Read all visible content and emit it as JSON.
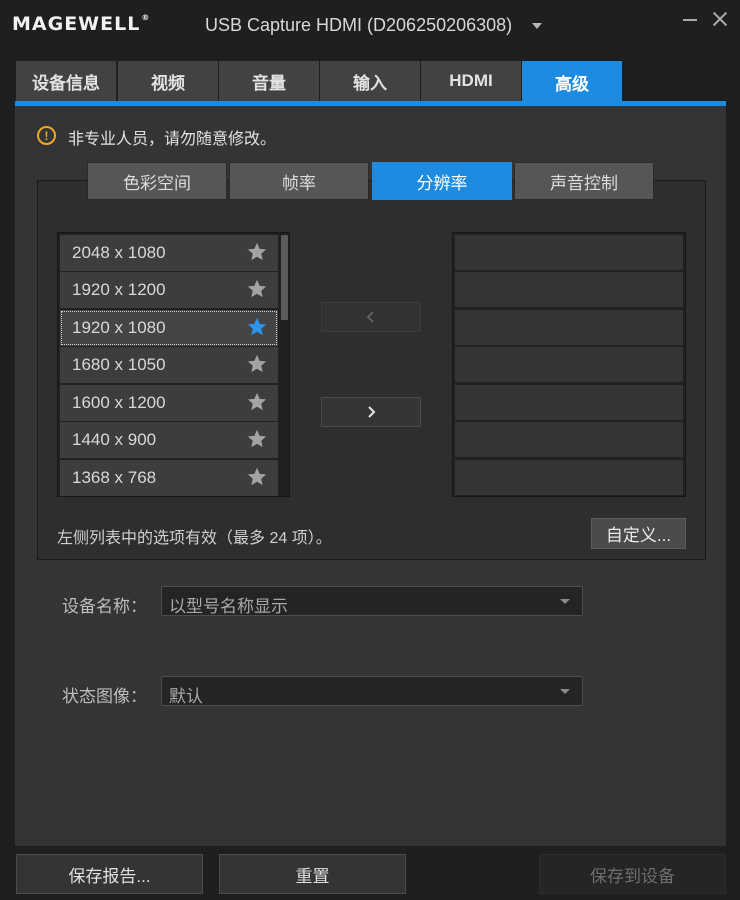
{
  "window": {
    "logo": "MAGEWELL",
    "logo_reg": "®",
    "device_title": "USB Capture HDMI (D206250206308)"
  },
  "tabs": [
    {
      "label": "设备信息",
      "active": false
    },
    {
      "label": "视频",
      "active": false
    },
    {
      "label": "音量",
      "active": false
    },
    {
      "label": "输入",
      "active": false
    },
    {
      "label": "HDMI",
      "active": false
    },
    {
      "label": "高级",
      "active": true
    }
  ],
  "warning": {
    "icon": "warning-icon",
    "text": "非专业人员，请勿随意修改。"
  },
  "subtabs": [
    {
      "label": "色彩空间",
      "active": false
    },
    {
      "label": "帧率",
      "active": false
    },
    {
      "label": "分辨率",
      "active": true
    },
    {
      "label": "声音控制",
      "active": false
    }
  ],
  "resolutions": [
    {
      "label": "2048 x 1080",
      "starred": false,
      "selected": false
    },
    {
      "label": "1920 x 1200",
      "starred": false,
      "selected": false
    },
    {
      "label": "1920 x 1080",
      "starred": true,
      "selected": true
    },
    {
      "label": "1680 x 1050",
      "starred": false,
      "selected": false
    },
    {
      "label": "1600 x 1200",
      "starred": false,
      "selected": false
    },
    {
      "label": "1440 x 900",
      "starred": false,
      "selected": false
    },
    {
      "label": "1368 x 768",
      "starred": false,
      "selected": false
    }
  ],
  "hint": "左侧列表中的选项有效（最多 24 项）。",
  "custom_button": "自定义...",
  "device_name": {
    "label": "设备名称：",
    "value": "以型号名称显示"
  },
  "status_image": {
    "label": "状态图像：",
    "value": "默认"
  },
  "bottom": {
    "save_report": "保存报告...",
    "reset": "重置",
    "save_to_device": "保存到设备"
  },
  "colors": {
    "accent": "#1d8be0",
    "warning": "#f2a623",
    "star_default": "#a3a3a3",
    "star_active": "#2b95ea"
  }
}
